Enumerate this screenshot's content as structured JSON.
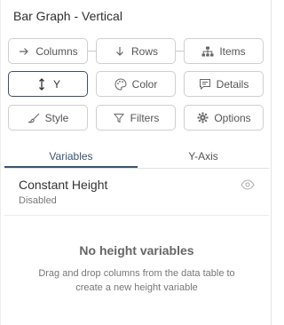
{
  "header": {
    "title": "Bar Graph - Vertical"
  },
  "buttons": {
    "columns": {
      "label": "Columns",
      "icon": "arrow-right-icon"
    },
    "rows": {
      "label": "Rows",
      "icon": "arrow-down-icon"
    },
    "items": {
      "label": "Items",
      "icon": "hierarchy-icon"
    },
    "y": {
      "label": "Y",
      "icon": "vertical-resize-icon"
    },
    "color": {
      "label": "Color",
      "icon": "palette-icon"
    },
    "details": {
      "label": "Details",
      "icon": "comment-icon"
    },
    "style": {
      "label": "Style",
      "icon": "brush-icon"
    },
    "filters": {
      "label": "Filters",
      "icon": "filter-icon"
    },
    "options": {
      "label": "Options",
      "icon": "gear-icon"
    }
  },
  "tabs": [
    {
      "label": "Variables",
      "active": true
    },
    {
      "label": "Y-Axis",
      "active": false
    }
  ],
  "variable": {
    "name": "Constant Height",
    "status": "Disabled",
    "icon": "eye-icon"
  },
  "empty_state": {
    "title": "No height variables",
    "description": "Drag and drop columns from the data table to create a new height variable"
  },
  "colors": {
    "accent": "#3a5470",
    "border": "#cfcfcf"
  }
}
